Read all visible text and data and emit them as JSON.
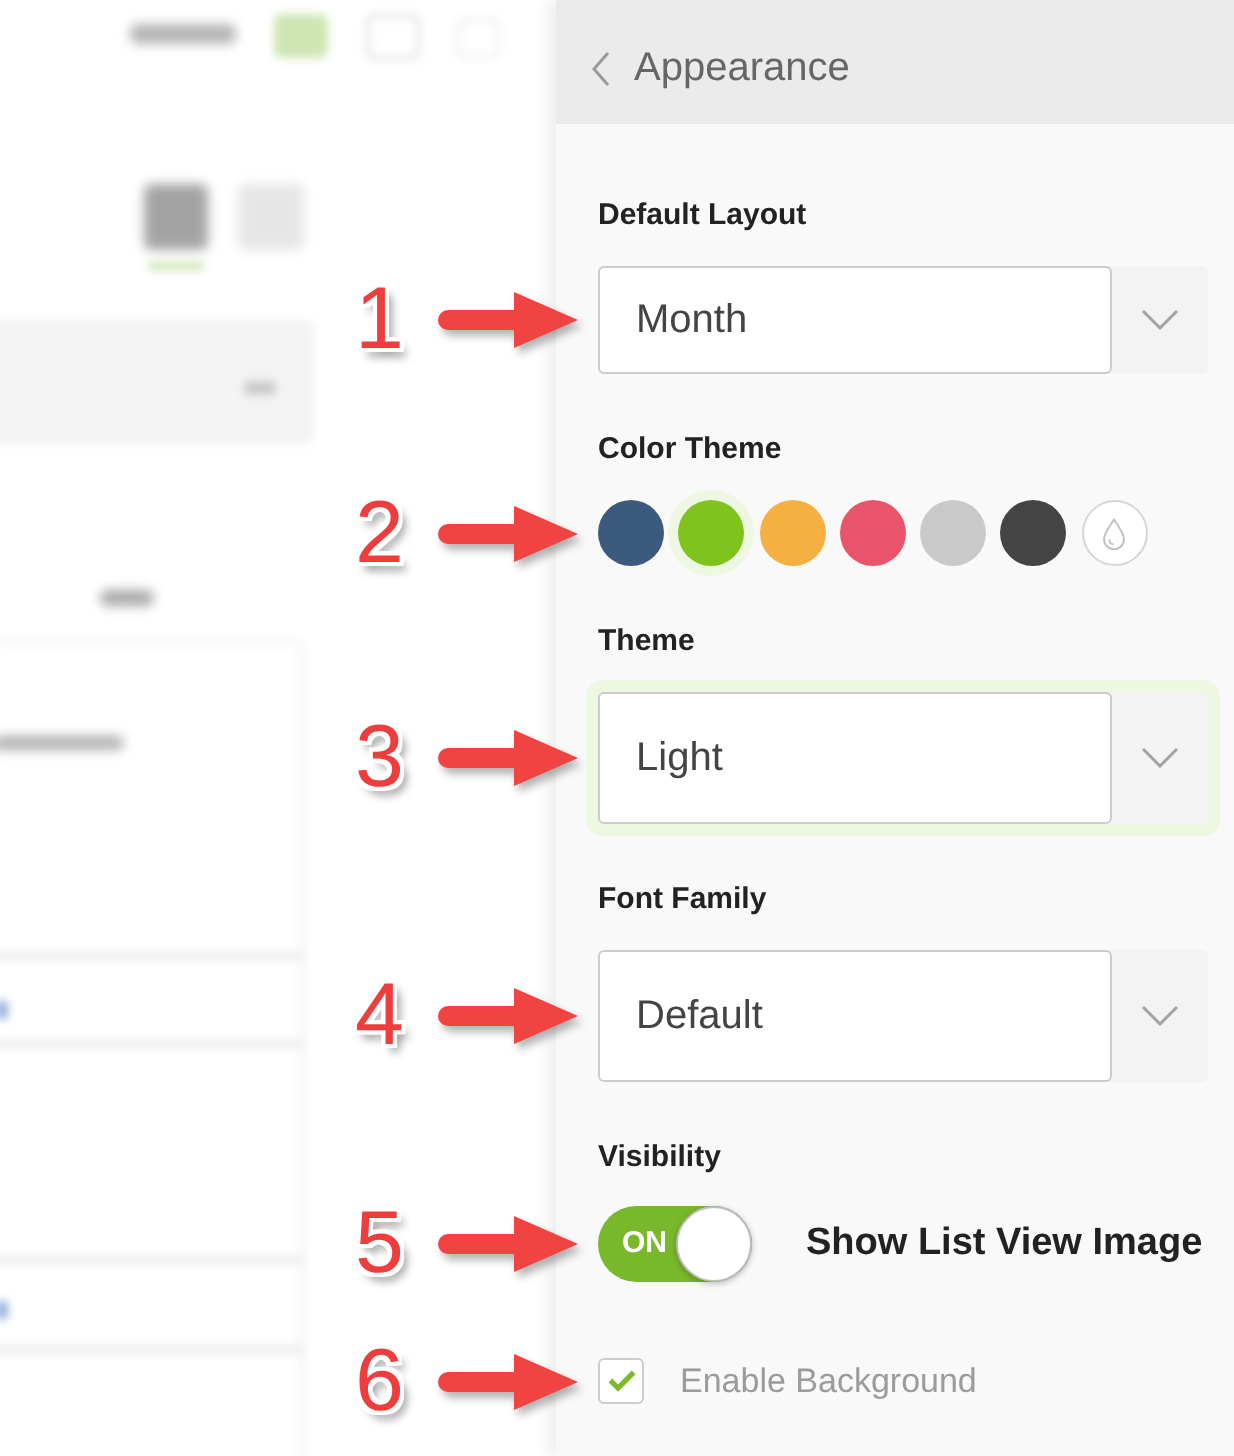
{
  "panel": {
    "title": "Appearance"
  },
  "settings": [
    {
      "kind": "select",
      "label": "Default Layout",
      "value": "Month",
      "focused": false,
      "callout": "1"
    },
    {
      "kind": "swatches",
      "label": "Color Theme",
      "callout": "2",
      "swatches": [
        {
          "kind": "color",
          "color": "#3b5a7e",
          "selected": false
        },
        {
          "kind": "color",
          "color": "#7fc31c",
          "selected": true
        },
        {
          "kind": "color",
          "color": "#f5b041",
          "selected": false
        },
        {
          "kind": "color",
          "color": "#e9546b",
          "selected": false
        },
        {
          "kind": "color",
          "color": "#c9c9c9",
          "selected": false
        },
        {
          "kind": "color",
          "color": "#444444",
          "selected": false
        },
        {
          "kind": "custom",
          "selected": false
        }
      ]
    },
    {
      "kind": "select",
      "label": "Theme",
      "value": "Light",
      "focused": true,
      "callout": "3"
    },
    {
      "kind": "select",
      "label": "Font Family",
      "value": "Default",
      "focused": false,
      "callout": "4"
    },
    {
      "kind": "toggle",
      "label": "Visibility",
      "on": true,
      "switch_text": "ON",
      "caption": "Show List View Image",
      "callout": "5"
    },
    {
      "kind": "checkbox",
      "label": "Enable Background",
      "checked": true,
      "callout": "6"
    }
  ]
}
